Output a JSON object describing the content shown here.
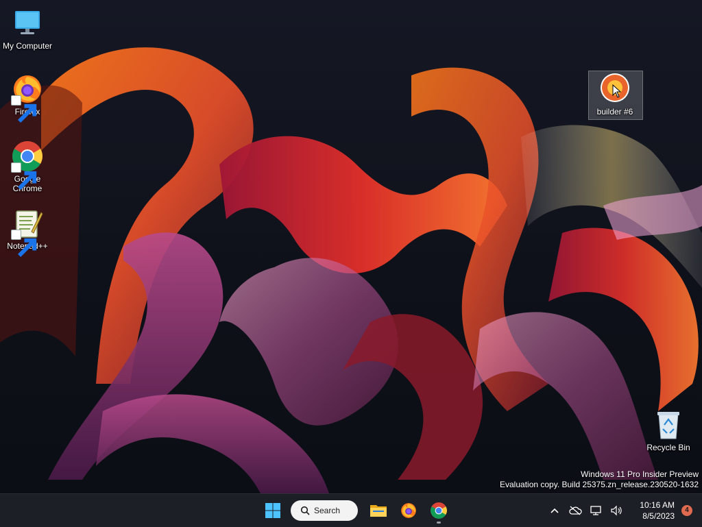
{
  "desktop": {
    "icons": [
      {
        "label": "My Computer",
        "icon": "computer-icon"
      },
      {
        "label": "Firefox",
        "icon": "firefox-icon"
      },
      {
        "label": "Google Chrome",
        "icon": "chrome-icon"
      },
      {
        "label": "Notepad++",
        "icon": "notepadpp-icon"
      },
      {
        "label": "builder #6",
        "icon": "builder-app-icon"
      },
      {
        "label": "Recycle Bin",
        "icon": "recycle-bin-icon"
      }
    ],
    "watermark": {
      "line1": "Windows 11 Pro Insider Preview",
      "line2": "Evaluation copy. Build 25375.zn_release.230520-1632"
    }
  },
  "taskbar": {
    "start_icon": "windows-start-icon",
    "search_label": "Search",
    "pinned": [
      {
        "name": "File Explorer",
        "icon": "file-explorer-icon"
      },
      {
        "name": "Firefox",
        "icon": "firefox-icon"
      },
      {
        "name": "Google Chrome",
        "icon": "chrome-icon",
        "running": true
      }
    ],
    "tray": {
      "time": "10:16 AM",
      "date": "8/5/2023",
      "notification_count": "4"
    }
  },
  "colors": {
    "taskbar_bg": "#1c1f26",
    "wallpaper_bg": "#0f111a",
    "accent_orange": "#e8642a",
    "notif_badge": "#e06a50"
  }
}
